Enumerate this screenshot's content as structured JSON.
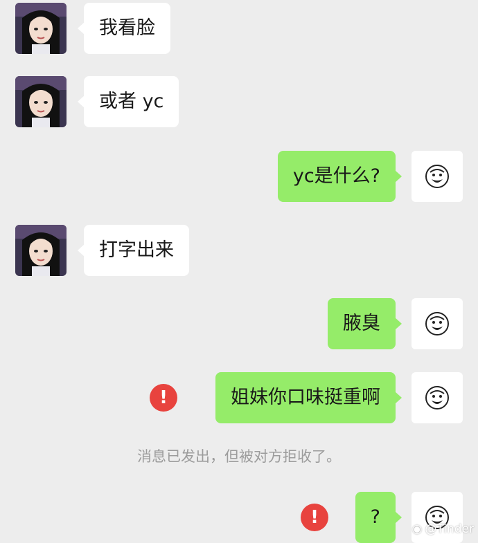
{
  "chat": {
    "messages": [
      {
        "side": "left",
        "text": "我看脸"
      },
      {
        "side": "left",
        "text": "或者 yc"
      },
      {
        "side": "right",
        "text": "yc是什么?"
      },
      {
        "side": "left",
        "text": "打字出来"
      },
      {
        "side": "right",
        "text": "腋臭"
      },
      {
        "side": "right",
        "text": "姐妹你口味挺重啊",
        "failed": true
      },
      {
        "side": "right",
        "text": "?",
        "failed": true
      }
    ],
    "error_glyph": "!",
    "rejected_notice": "消息已发出，但被对方拒收了。"
  },
  "watermark": {
    "text": "@Tinder"
  },
  "colors": {
    "background": "#ededed",
    "incoming_bubble": "#ffffff",
    "outgoing_bubble": "#95ec69",
    "error": "#e8433e"
  }
}
